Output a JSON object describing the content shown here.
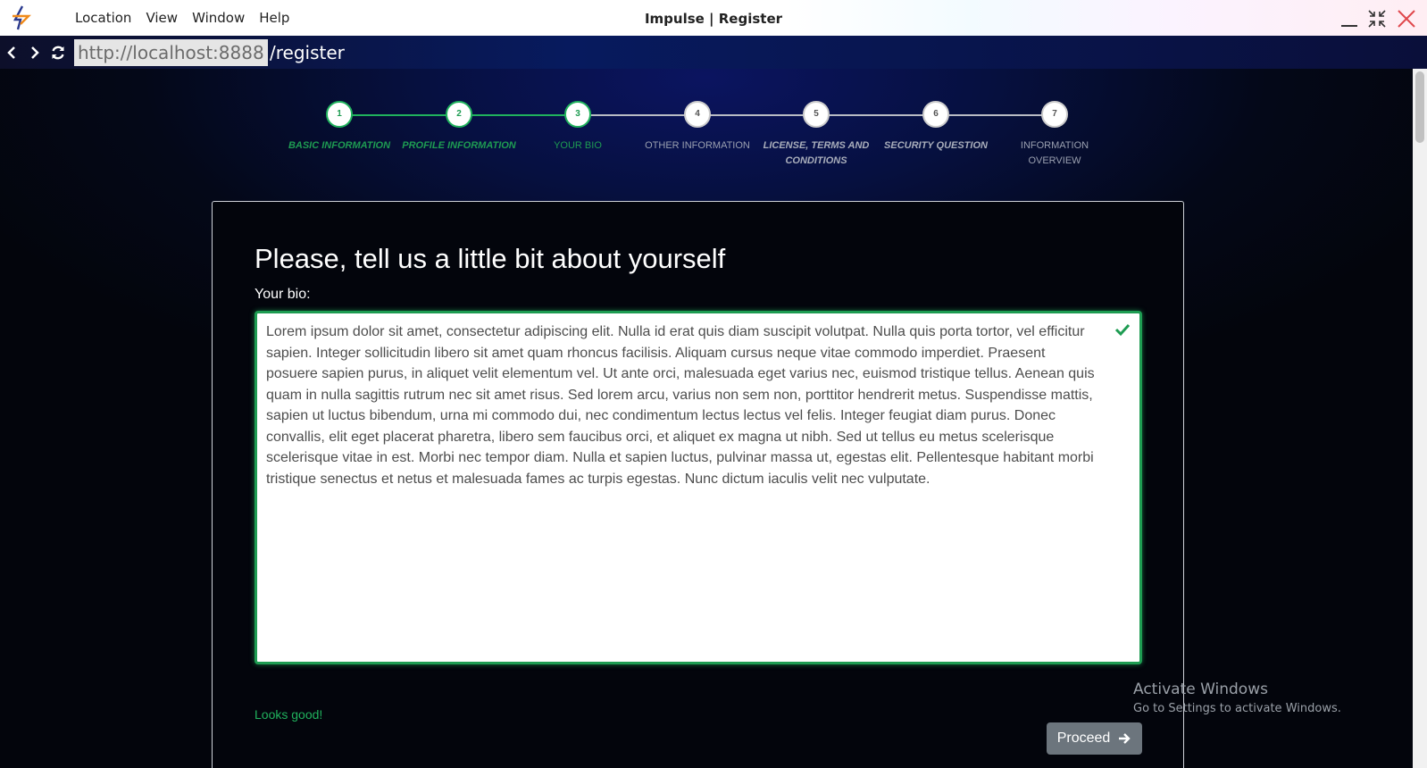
{
  "window": {
    "title": "Impulse | Register",
    "menu": [
      "Location",
      "View",
      "Window",
      "Help"
    ]
  },
  "address": {
    "host": "http://localhost:8888",
    "path": "/register"
  },
  "stepper": {
    "steps": [
      {
        "number": "1",
        "label": "BASIC INFORMATION",
        "state": "done"
      },
      {
        "number": "2",
        "label": "PROFILE INFORMATION",
        "state": "done"
      },
      {
        "number": "3",
        "label": "YOUR BIO",
        "state": "current"
      },
      {
        "number": "4",
        "label": "OTHER INFORMATION",
        "state": "pending"
      },
      {
        "number": "5",
        "label": "LICENSE, TERMS AND CONDITIONS",
        "state": "pending"
      },
      {
        "number": "6",
        "label": "SECURITY QUESTION",
        "state": "pending"
      },
      {
        "number": "7",
        "label": "INFORMATION OVERVIEW",
        "state": "pending"
      }
    ]
  },
  "form": {
    "title": "Please, tell us a little bit about yourself",
    "bio_label": "Your bio:",
    "bio_value": "Lorem ipsum dolor sit amet, consectetur adipiscing elit. Nulla id erat quis diam suscipit volutpat. Nulla quis porta tortor, vel efficitur sapien. Integer sollicitudin libero sit amet quam rhoncus facilisis. Aliquam cursus neque vitae commodo imperdiet. Praesent posuere sapien purus, in aliquet velit elementum vel. Ut ante orci, malesuada eget varius nec, euismod tristique tellus. Aenean quis quam in nulla sagittis rutrum nec sit amet risus. Sed lorem arcu, varius non sem non, porttitor hendrerit metus. Suspendisse mattis, sapien ut luctus bibendum, urna mi commodo dui, nec condimentum lectus lectus vel felis. Integer feugiat diam purus. Donec convallis, elit eget placerat pharetra, libero sem faucibus orci, et aliquet ex magna ut nibh. Sed ut tellus eu metus scelerisque scelerisque vitae in est. Morbi nec tempor diam. Nulla et sapien luctus, pulvinar massa ut, egestas elit. Pellentesque habitant morbi tristique senectus et netus et malesuada fames ac turpis egestas. Nunc dictum iaculis velit nec vulputate.",
    "feedback": "Looks good!",
    "proceed_label": "Proceed"
  },
  "watermark": {
    "line1": "Activate Windows",
    "line2": "Go to Settings to activate Windows."
  },
  "colors": {
    "accent_green": "#1e9c52",
    "button_gray": "#6c757d"
  }
}
